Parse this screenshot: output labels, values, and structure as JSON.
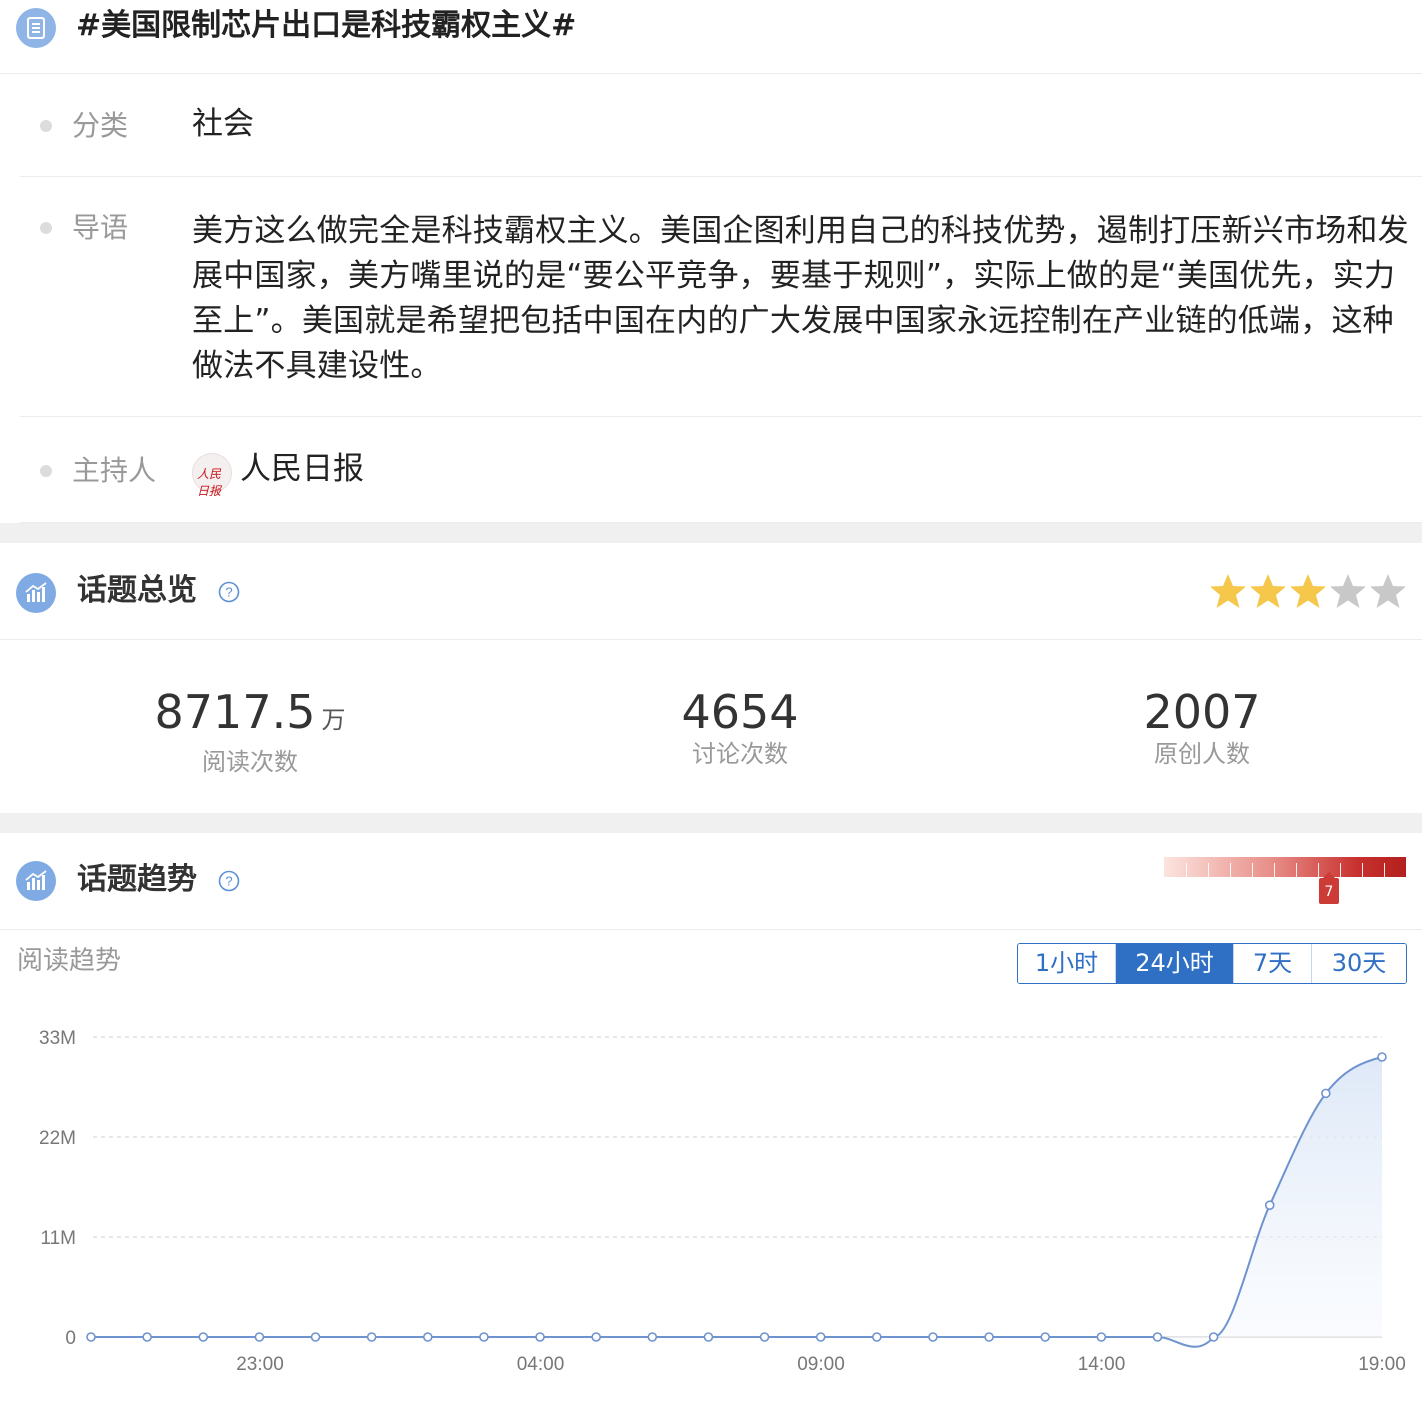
{
  "topic": {
    "title": "#美国限制芯片出口是科技霸权主义#",
    "icon": "list-doc-icon"
  },
  "info": {
    "category_label": "分类",
    "category_value": "社会",
    "intro_label": "导语",
    "intro_value": "美方这么做完全是科技霸权主义。美国企图利用自己的科技优势，遏制打压新兴市场和发展中国家，美方嘴里说的是“要公平竞争，要基于规则”，实际上做的是“美国优先，实力至上”。美国就是希望把包括中国在内的广大发展中国家永远控制在产业链的低端，这种做法不具建设性。",
    "host_label": "主持人",
    "host_name": "人民日报",
    "host_logo_text": "人民日报"
  },
  "overview": {
    "title": "话题总览",
    "rating": 3,
    "max_rating": 5,
    "star_on_color": "#f5c84c",
    "star_off_color": "#c8c8c8",
    "stats": [
      {
        "value": "8717.5",
        "unit": "万",
        "label": "阅读次数"
      },
      {
        "value": "4654",
        "unit": "",
        "label": "讨论次数"
      },
      {
        "value": "2007",
        "unit": "",
        "label": "原创人数"
      }
    ]
  },
  "trend": {
    "title": "话题趋势",
    "heat_level": "7",
    "read_trend_label": "阅读趋势",
    "ranges": [
      {
        "label": "1小时",
        "active": false
      },
      {
        "label": "24小时",
        "active": true
      },
      {
        "label": "7天",
        "active": false
      },
      {
        "label": "30天",
        "active": false
      }
    ]
  },
  "chart_data": {
    "type": "area",
    "title": "",
    "xlabel": "",
    "ylabel": "",
    "x_ticks": [
      "23:00",
      "04:00",
      "09:00",
      "14:00",
      "19:00"
    ],
    "y_ticks": [
      "0",
      "11M",
      "22M",
      "33M"
    ],
    "ylim": [
      0,
      33000000
    ],
    "grid": true,
    "line_color": "#6e93cf",
    "series": [
      {
        "x": [
          "20:00",
          "21:00",
          "22:00",
          "23:00",
          "00:00",
          "01:00",
          "02:00",
          "03:00",
          "04:00",
          "05:00",
          "06:00",
          "07:00",
          "08:00",
          "09:00",
          "10:00",
          "11:00",
          "12:00",
          "13:00",
          "14:00",
          "15:00",
          "16:00",
          "17:00",
          "18:00",
          "19:00"
        ],
        "values": [
          0,
          0,
          0,
          0,
          0,
          0,
          0,
          0,
          0,
          0,
          0,
          0,
          0,
          0,
          0,
          0,
          0,
          0,
          0,
          0,
          0,
          14500000,
          26800000,
          30800000
        ]
      }
    ]
  }
}
